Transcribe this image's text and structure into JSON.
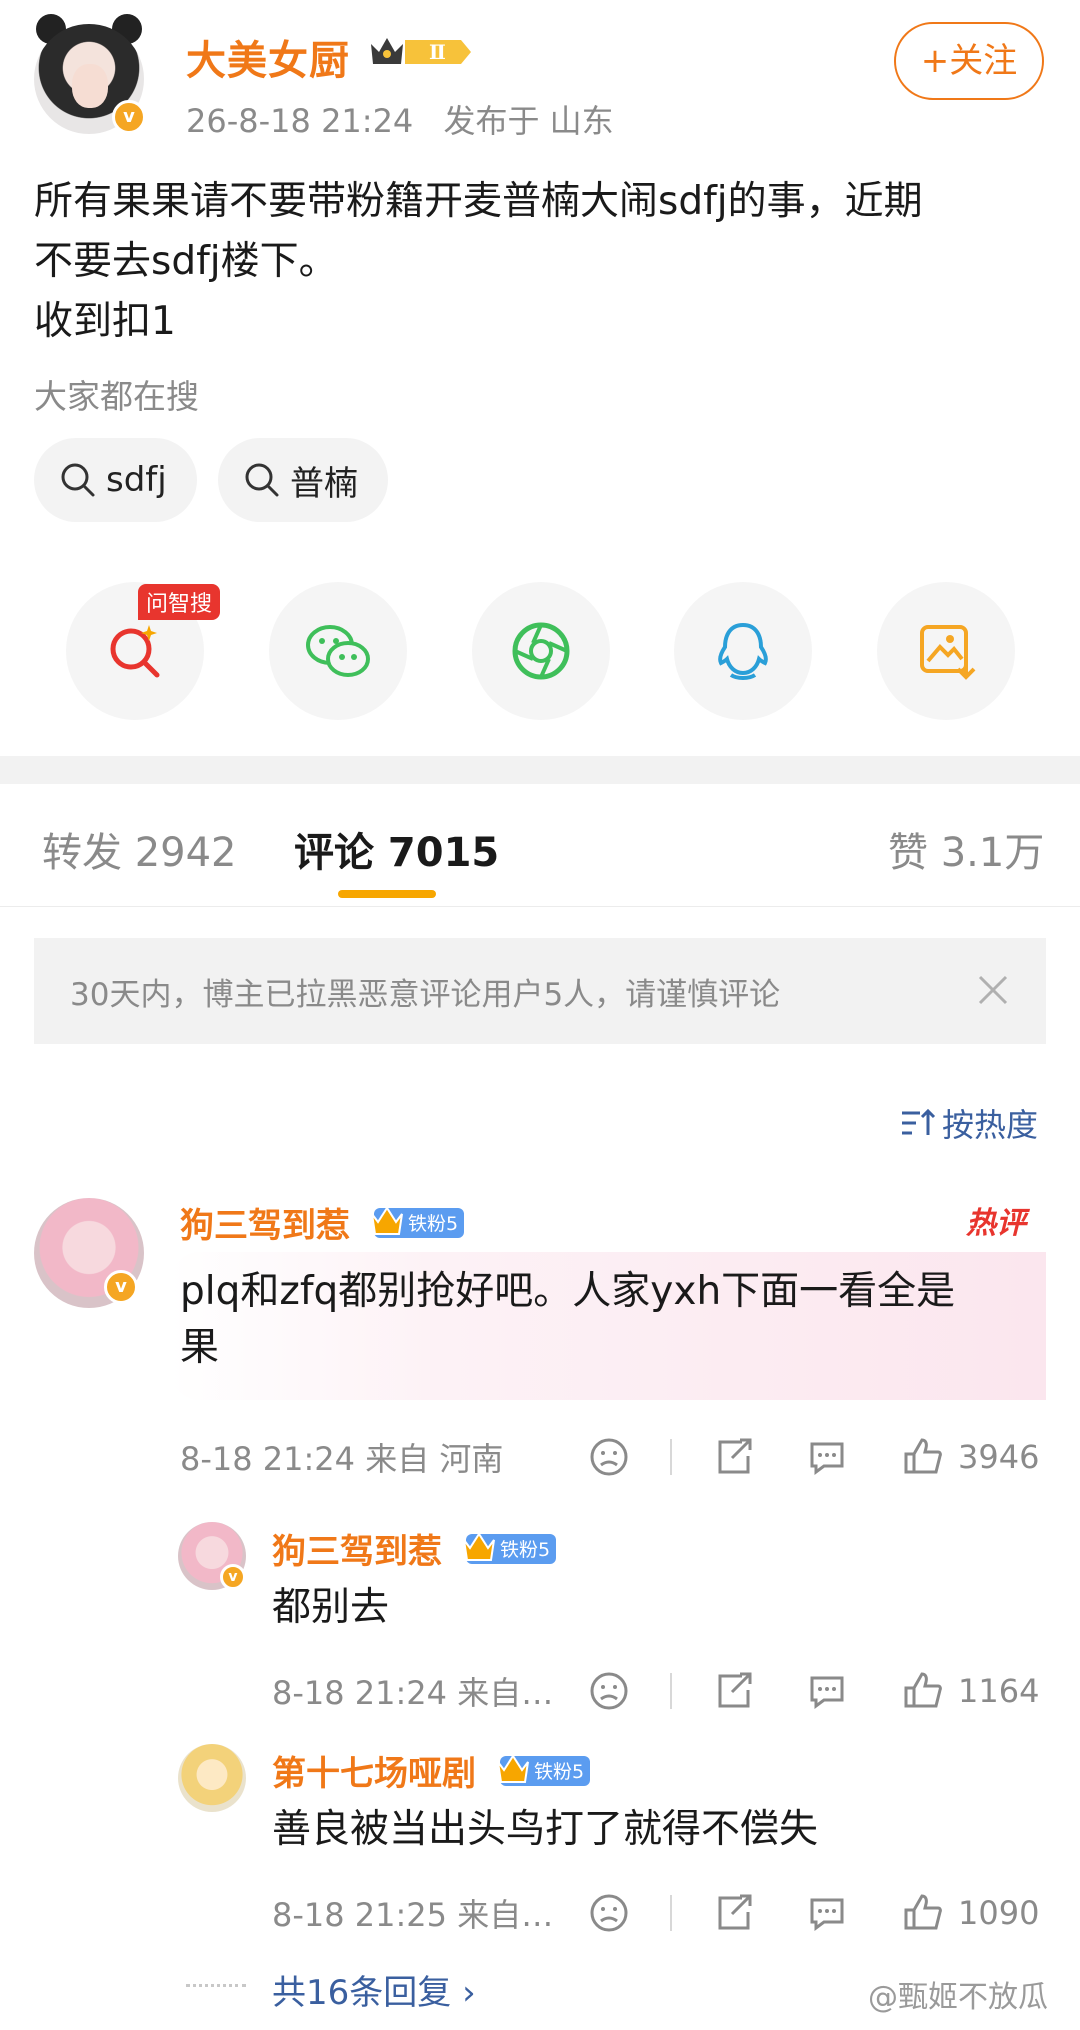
{
  "post": {
    "username": "大美女厨",
    "level_badge": "Ⅱ",
    "timestamp": "26-8-18 21:24",
    "location": "发布于 山东",
    "follow_label": "+关注",
    "content": "所有果果请不要带粉籍开麦普楠大闹sdfj的事，近期\n不要去sdfj楼下。\n收到扣1",
    "search_label": "大家都在搜",
    "search_chips": [
      "sdfj",
      "普楠"
    ],
    "ask_tag": "问智搜"
  },
  "tabs": {
    "repost": "转发 2942",
    "comments": "评论 7015",
    "likes": "赞 3.1万"
  },
  "notice": "30天内，博主已拉黑恶意评论用户5人，请谨慎评论",
  "sort_label": "按热度",
  "comments": [
    {
      "name": "狗三驾到惹",
      "fan_badge": "铁粉5",
      "hot_label": "热评",
      "text": "plq和zfq都别抢好吧。人家yxh下面一看全是\n果",
      "meta": "8-18 21:24 来自 河南",
      "likes": "3946"
    }
  ],
  "replies": [
    {
      "name": "狗三驾到惹",
      "fan_badge": "铁粉5",
      "text": "都别去",
      "meta": "8-18 21:24 来自…",
      "likes": "1164"
    },
    {
      "name": "第十七场哑剧",
      "fan_badge": "铁粉5",
      "text": "善良被当出头鸟打了就得不偿失",
      "meta": "8-18 21:25 来自…",
      "likes": "1090"
    }
  ],
  "more_replies": "共16条回复 ›",
  "watermark": "@甄姬不放瓜",
  "colors": {
    "accent": "#f07818",
    "link": "#3a5f9f",
    "hot": "#e8352e",
    "tab_underline": "#f7a600"
  }
}
